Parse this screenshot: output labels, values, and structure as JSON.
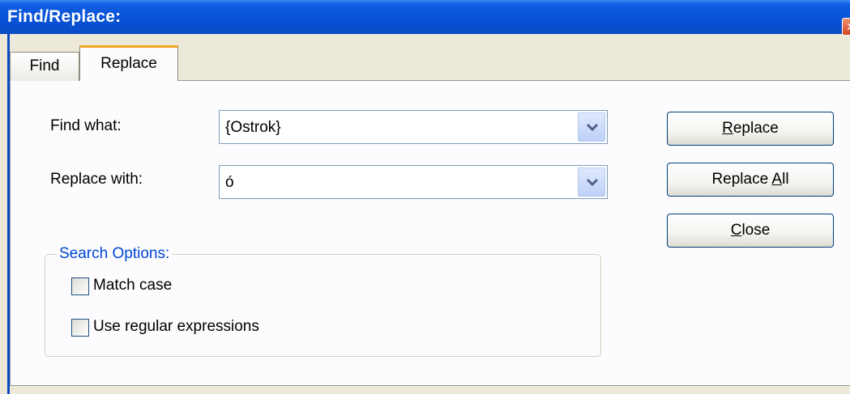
{
  "window": {
    "title": "Find/Replace:",
    "close_glyph": "✕"
  },
  "tabs": [
    {
      "label": "Find"
    },
    {
      "label": "Replace"
    }
  ],
  "form": {
    "find_label": "Find what:",
    "find_value": "{Ostrok}",
    "replace_label": "Replace with:",
    "replace_value": "ó"
  },
  "buttons": {
    "replace_pre": "",
    "replace_key": "R",
    "replace_post": "eplace",
    "replace_all_pre": "Replace ",
    "replace_all_key": "A",
    "replace_all_post": "ll",
    "close_pre": "",
    "close_key": "C",
    "close_post": "lose"
  },
  "search_options": {
    "title": "Search Options:",
    "match_case": "Match case",
    "use_regex": "Use regular expressions"
  },
  "colors": {
    "titlebar": "#0a55d9",
    "tab_highlight": "#f5a623",
    "group_title": "#0046d5",
    "window_bg": "#ece9d8"
  },
  "icons": {
    "dropdown": "chevron-down-icon",
    "close": "close-icon"
  }
}
